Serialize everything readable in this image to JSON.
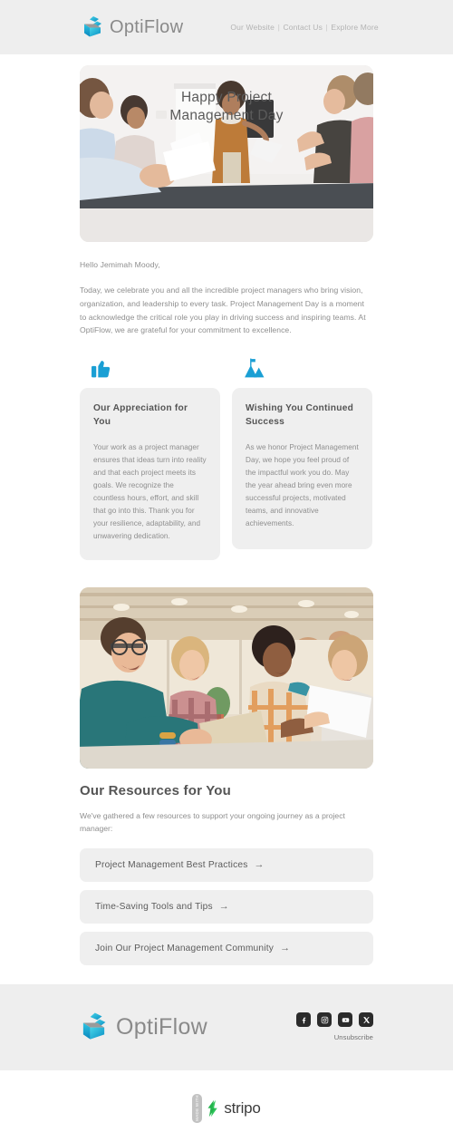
{
  "brand": {
    "name": "OptiFlow",
    "logo_color_light": "#29c3e0",
    "logo_color_dark": "#0b8fc4"
  },
  "header": {
    "nav": [
      {
        "label": "Our Website"
      },
      {
        "label": "Contact Us"
      },
      {
        "label": "Explore More"
      }
    ],
    "separator": "|",
    "background": "#eeeeee"
  },
  "hero": {
    "title_line1": "Happy Project",
    "title_line2": "Management Day",
    "alt": "team meeting in conference room with presenter at flipchart"
  },
  "body": {
    "greeting": "Hello Jemimah Moody,",
    "paragraph": "Today, we celebrate you and all the incredible project managers who bring vision, organization, and leadership to every task. Project Management Day is a moment to acknowledge the critical role you play in driving success and inspiring teams. At OptiFlow, we are grateful for your commitment to excellence."
  },
  "cards": [
    {
      "icon": "thumbs-up-icon",
      "title": "Our Appreciation for You",
      "text": "Your work as a project manager ensures that ideas turn into reality and that each project meets its goals. We recognize the countless hours, effort, and skill that go into this. Thank you for your resilience, adaptability, and unwavering dedication."
    },
    {
      "icon": "mountain-flag-icon",
      "title": "Wishing You Continued Success",
      "text": "As we honor Project Management Day, we hope you feel proud of the impactful work you do. May the year ahead bring even more successful projects, motivated teams, and innovative achievements."
    }
  ],
  "photo2": {
    "alt": "four colleagues smiling together around a table with a tablet in a modern office"
  },
  "resources": {
    "heading": "Our Resources for You",
    "subtitle": "We've gathered a few resources to support your ongoing journey as a project manager:",
    "arrow": "→",
    "items": [
      {
        "label": "Project Management Best Practices"
      },
      {
        "label": "Time-Saving Tools and Tips"
      },
      {
        "label": "Join Our Project Management Community"
      }
    ]
  },
  "footer": {
    "brand_name": "OptiFlow",
    "background": "#eeeeee",
    "social": [
      {
        "name": "facebook-icon"
      },
      {
        "name": "instagram-icon"
      },
      {
        "name": "youtube-icon"
      },
      {
        "name": "x-twitter-icon"
      }
    ],
    "unsubscribe": "Unsubscribe"
  },
  "stripo": {
    "made_with": "MADE WITH",
    "word": "stripo",
    "accent": "#30c65c"
  }
}
